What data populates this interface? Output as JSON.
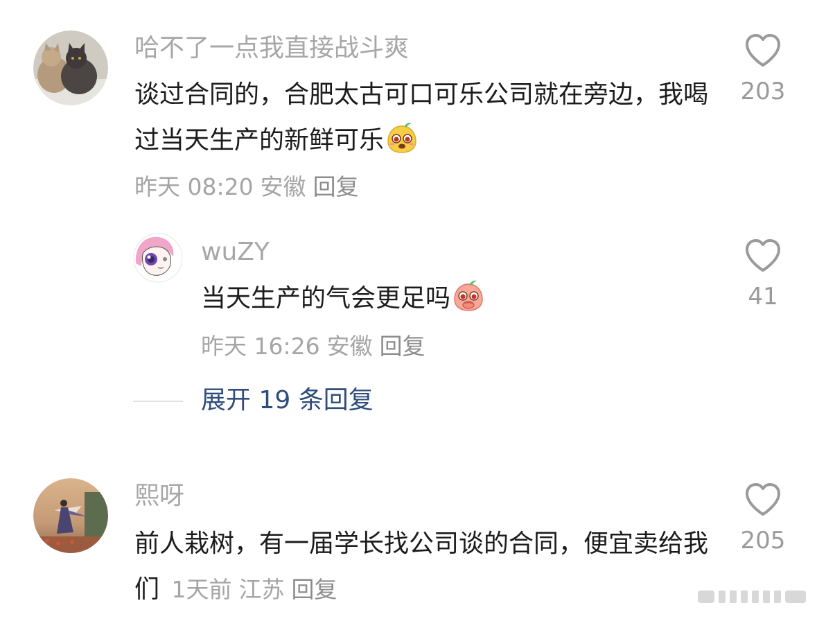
{
  "comments": [
    {
      "username": "哈不了一点我直接战斗爽",
      "text": "谈过合同的，合肥太古可口可乐公司就在旁边，我喝过当天生产的新鲜可乐",
      "emoji_icon": "yellow-smile-emoji",
      "time": "昨天 08:20",
      "location": "安徽",
      "reply_label": "回复",
      "likes": "203",
      "avatar_icon": "cats-avatar"
    },
    {
      "username": "wuZY",
      "text": "当天生产的气会更足吗",
      "emoji_icon": "pink-surprised-emoji",
      "time": "昨天 16:26",
      "location": "安徽",
      "reply_label": "回复",
      "likes": "41",
      "avatar_icon": "anime-girl-avatar"
    },
    {
      "username": "熙呀",
      "text": "前人栽树，有一届学长找公司谈的合同，便宜卖给我们",
      "time": "1天前",
      "location": "江苏",
      "reply_label": "回复",
      "likes": "205",
      "avatar_icon": "sunset-figure-avatar"
    }
  ],
  "expand_replies": "展开 19 条回复",
  "colors": {
    "username": "#a7a7a7",
    "text": "#1c1c1c",
    "link": "#2f4d7a",
    "background": "#ffffff"
  }
}
